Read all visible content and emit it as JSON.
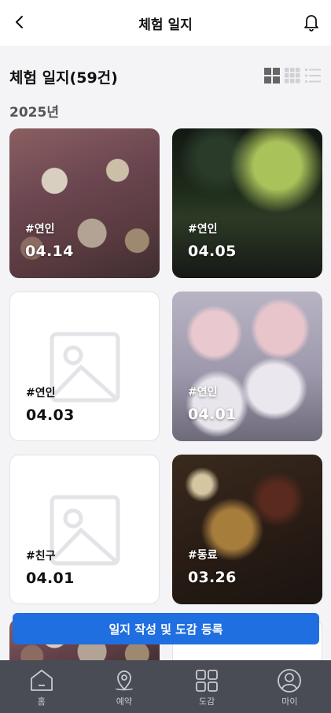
{
  "header": {
    "title": "체험 일지"
  },
  "section": {
    "title": "체험 일지(59건)"
  },
  "year": "2025년",
  "cards": [
    {
      "tag": "#연인",
      "date": "04.14",
      "has_photo": true
    },
    {
      "tag": "#연인",
      "date": "04.05",
      "has_photo": true
    },
    {
      "tag": "#연인",
      "date": "04.03",
      "has_photo": false
    },
    {
      "tag": "#연인",
      "date": "04.01",
      "has_photo": true
    },
    {
      "tag": "#친구",
      "date": "04.01",
      "has_photo": false
    },
    {
      "tag": "#동료",
      "date": "03.26",
      "has_photo": true
    }
  ],
  "cta": {
    "label": "일지 작성 및 도감 등록"
  },
  "tabs": [
    {
      "label": "홈",
      "icon": "home-icon"
    },
    {
      "label": "예약",
      "icon": "map-pin-icon"
    },
    {
      "label": "도감",
      "icon": "grid-icon"
    },
    {
      "label": "마이",
      "icon": "user-icon"
    }
  ],
  "colors": {
    "accent": "#1f6fe0",
    "tabbar": "#4a4c55",
    "background": "#f4f4f6"
  }
}
